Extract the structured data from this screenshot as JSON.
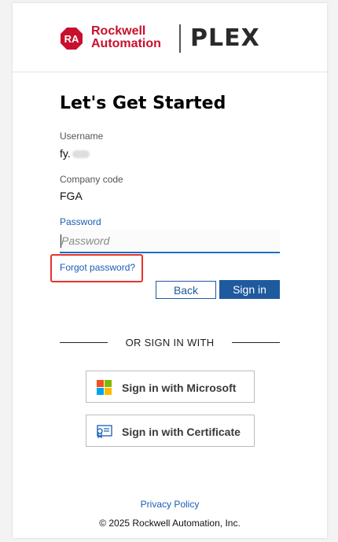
{
  "header": {
    "badge_text": "RA",
    "brand_line1": "Rockwell",
    "brand_line2": "Automation",
    "product": "PLEX",
    "colors": {
      "brand_red": "#c8102e",
      "product": "#2a2a2a"
    }
  },
  "form": {
    "title": "Let's Get Started",
    "username_label": "Username",
    "username_value": "fy.",
    "company_label": "Company code",
    "company_value": "FGA",
    "password_label": "Password",
    "password_placeholder": "Password",
    "password_value": "",
    "forgot_link": "Forgot password?",
    "back_button": "Back",
    "signin_button": "Sign in",
    "colors": {
      "primary": "#1f5a9e",
      "link": "#1a5db4",
      "highlight": "#e8332b"
    }
  },
  "alt_signin": {
    "divider_text": "OR SIGN IN WITH",
    "microsoft_button": "Sign in with Microsoft",
    "microsoft_icon": "microsoft-logo-icon",
    "certificate_button": "Sign in with Certificate",
    "certificate_icon": "certificate-icon"
  },
  "footer": {
    "privacy_link": "Privacy Policy",
    "copyright": "© 2025 Rockwell Automation, Inc."
  }
}
